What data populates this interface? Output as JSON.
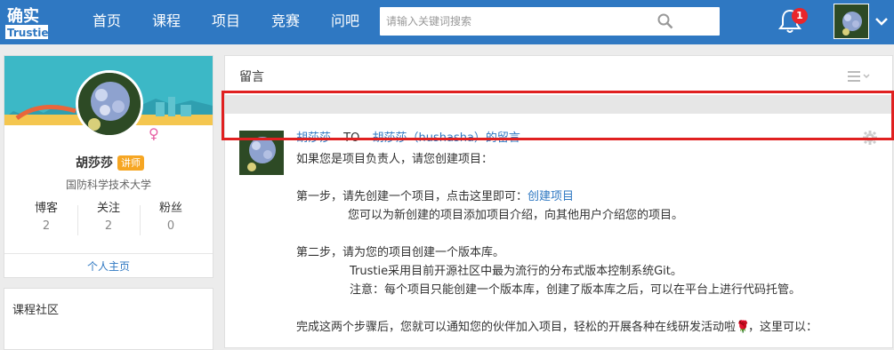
{
  "header": {
    "logo_text": "确实 Trustie",
    "nav": [
      "首页",
      "课程",
      "项目",
      "竞赛",
      "问吧"
    ],
    "search_placeholder": "请输入关键词搜索",
    "notification_count": "1"
  },
  "profile": {
    "name": "胡莎莎",
    "role_badge": "讲师",
    "school": "国防科学技术大学",
    "stats": [
      {
        "label": "博客",
        "value": "2"
      },
      {
        "label": "关注",
        "value": "2"
      },
      {
        "label": "粉丝",
        "value": "0"
      }
    ],
    "home_link": "个人主页"
  },
  "sidebar2": {
    "title": "课程社区"
  },
  "message": {
    "section_title": "留言",
    "from_user": "胡莎莎",
    "to_word": "TO",
    "to_target": "胡莎莎（hushasha）的留言",
    "lines": {
      "l1": "如果您是项目负责人，请您创建项目：",
      "l2_prefix": "第一步，请先创建一个项目，点击这里即可：",
      "l2_link": "创建项目",
      "l3": "您可以为新创建的项目添加项目介绍，向其他用户介绍您的项目。",
      "l4": "第二步，请为您的项目创建一个版本库。",
      "l5": "Trustie采用目前开源社区中最为流行的分布式版本控制系统Git。",
      "l6": "注意：每个项目只能创建一个版本库，创建了版本库之后，可以在平台上进行代码托管。",
      "l7_prefix": "完成这两个步骤后，您就可以通知您的伙伴加入项目，轻松的开展各种在线研发活动啦",
      "l7_suffix": "，这里可以："
    }
  },
  "colors": {
    "topbar": "#2f78c2",
    "link": "#2f78c2",
    "highlight": "#e02020",
    "badge": "#f6a623"
  }
}
